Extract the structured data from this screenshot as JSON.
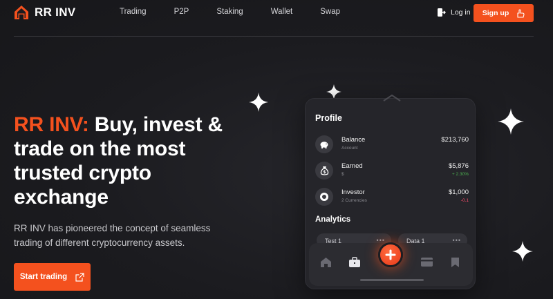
{
  "nav": {
    "brand_name": "RR INV",
    "links": [
      "Trading",
      "P2P",
      "Staking",
      "Wallet",
      "Swap"
    ],
    "login_label": "Log in",
    "signup_label": "Sign up"
  },
  "hero": {
    "title_accent": "RR INV:",
    "title_rest": " Buy, invest & trade on the most trusted crypto exchange",
    "subtitle": "RR INV has pioneered the concept of seamless trading of different cryptocurrency assets.",
    "cta_label": "Start trading"
  },
  "phone": {
    "profile_heading": "Profile",
    "rows": [
      {
        "label": "Balance",
        "sub": "Account",
        "value": "$213,760",
        "change": ""
      },
      {
        "label": "Earned",
        "sub": "$",
        "value": "$5,876",
        "change": "+ 2.30%"
      },
      {
        "label": "Investor",
        "sub": "2 Currencies",
        "value": "$1,000",
        "change": "-0.1"
      }
    ],
    "analytics_heading": "Analytics",
    "tags": [
      "Test 1",
      "Data 1"
    ],
    "tag_menu": "•••"
  },
  "icons": {
    "logo": "house-logo-icon",
    "login": "login-icon",
    "signup": "hand-icon",
    "cta": "external-link-icon",
    "balance": "piggy-bank-icon",
    "earned": "money-bag-icon",
    "investor": "target-icon",
    "tabs": [
      "home-icon",
      "briefcase-icon",
      "plus-icon",
      "card-icon",
      "bookmark-icon"
    ]
  },
  "colors": {
    "accent": "#f4511e",
    "background": "#1b1b1f",
    "positive": "#4caf50",
    "negative": "#ff4d6d"
  }
}
